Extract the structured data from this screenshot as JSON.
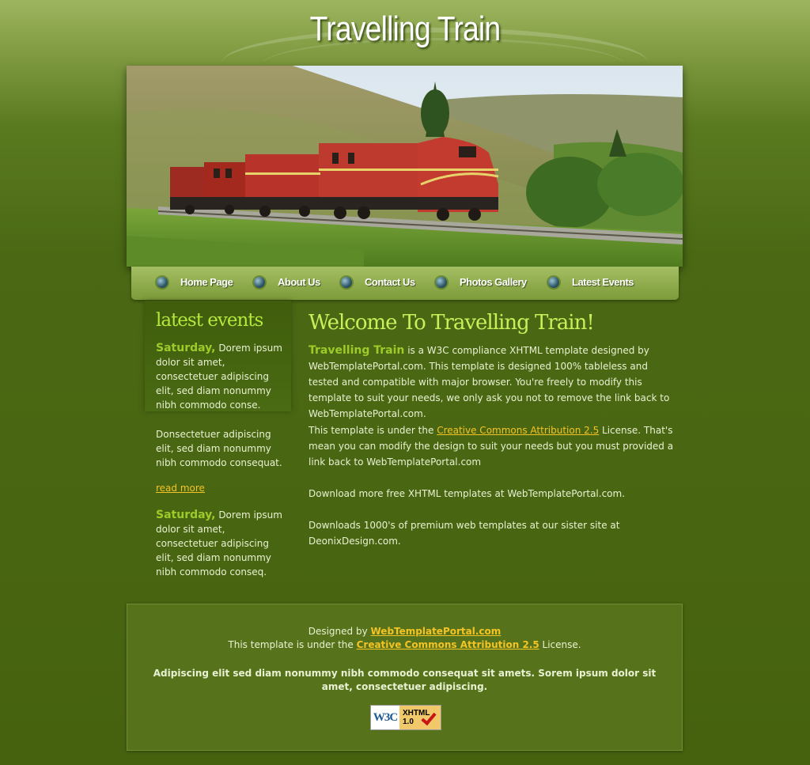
{
  "header": {
    "site_title": "Travelling Train"
  },
  "nav": {
    "items": [
      {
        "label": "Home Page"
      },
      {
        "label": "About Us"
      },
      {
        "label": "Contact Us"
      },
      {
        "label": "Photos Gallery"
      },
      {
        "label": "Latest Events"
      }
    ]
  },
  "sidebar": {
    "title": "latest events",
    "event1_day": "Saturday,",
    "event1_text": " Dorem ipsum dolor sit amet, consectetuer adipiscing elit, sed diam nonummy nibh commodo conse.",
    "paragraph": "Donsectetuer adipiscing elit, sed diam nonummy nibh commodo consequat.",
    "read_more": "read more",
    "event2_day": "Saturday,",
    "event2_text": " Dorem ipsum dolor sit amet, consectetuer adipiscing elit, sed diam nonummy nibh commodo conseq."
  },
  "main": {
    "title": "Welcome To Travelling Train!",
    "p1_brand": "Travelling Train",
    "p1_text": " is a W3C compliance XHTML template designed by WebTemplatePortal.com. This template is designed 100% tableless and tested and compatible with major browser. You're freely to modify this template to suit your needs, we only ask you not to remove the link back to WebTemplatePortal.com.",
    "p2_pre": "This template is under the ",
    "p2_link": "Creative Commons Attribution 2.5",
    "p2_post": " License. That's mean you can modify the design to suit your needs but you must provided a link back to WebTemplatePortal.com",
    "p3": "Download more free XHTML templates at WebTemplatePortal.com.",
    "p4": "Downloads 1000's of premium web templates at our sister site at DeonixDesign.com."
  },
  "footer": {
    "designed_by": "Designed by ",
    "designer_link": "WebTemplatePortal.com",
    "license_pre": "This template is under the ",
    "license_link": "Creative Commons Attribution 2.5",
    "license_post": " License.",
    "bold_text": "Adipiscing elit sed diam nonummy nibh commodo consequat sit amets. Sorem ipsum dolor sit amet, consectetuer adipiscing.",
    "badge_w3c": "W3C",
    "badge_xhtml": "XHTML",
    "badge_version": "1.0"
  },
  "colors": {
    "accent_green": "#9ecb2a",
    "title_green": "#c8f05a",
    "link_yellow": "#f5c324",
    "background": "#4b6914"
  }
}
